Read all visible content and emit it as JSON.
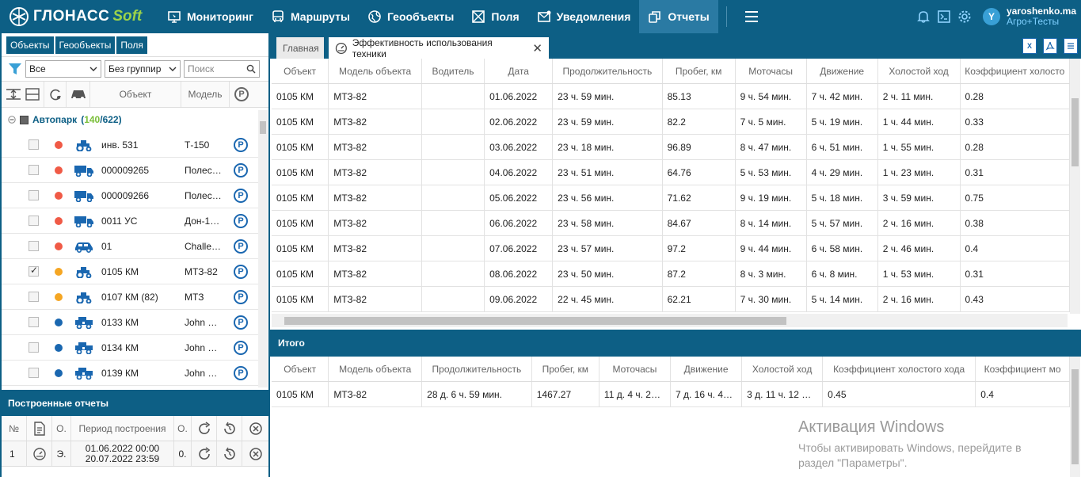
{
  "app": {
    "logo_main": "ГЛОНАСС",
    "logo_soft": "Soft",
    "nav": [
      {
        "label": "Мониторинг",
        "icon": "monitor-icon"
      },
      {
        "label": "Маршруты",
        "icon": "bus-icon"
      },
      {
        "label": "Геообъекты",
        "icon": "globe-icon"
      },
      {
        "label": "Поля",
        "icon": "field-icon"
      },
      {
        "label": "Уведомления",
        "icon": "mail-icon"
      },
      {
        "label": "Отчеты",
        "icon": "reports-icon"
      }
    ],
    "active_nav": "Отчеты",
    "user": {
      "initial": "Y",
      "name": "yaroshenko.ma",
      "org": "Агро+Тесты"
    }
  },
  "left": {
    "tabs": [
      "Объекты",
      "Геообъекты",
      "Поля"
    ],
    "filter_select": "Все",
    "group_select": "Без группир",
    "search_placeholder": "Поиск",
    "columns": {
      "object": "Объект",
      "model": "Модель"
    },
    "group": {
      "name": "Автопарк",
      "open_paren": "(",
      "online": "140",
      "slash": "/",
      "total": "622",
      "close_paren": ")"
    },
    "objects": [
      {
        "name": "инв. 531",
        "model": "Т-150",
        "status": "#f05a46",
        "vehicle": "tractor",
        "checked": false
      },
      {
        "name": "000009265",
        "model": "Полес…",
        "status": "#f05a46",
        "vehicle": "truck",
        "checked": false
      },
      {
        "name": "000009266",
        "model": "Полес…",
        "status": "#f05a46",
        "vehicle": "truck",
        "checked": false
      },
      {
        "name": "0011 УС",
        "model": "Дон-1…",
        "status": "#f05a46",
        "vehicle": "truck",
        "checked": false
      },
      {
        "name": "01",
        "model": "Challe…",
        "status": "#f05a46",
        "vehicle": "car",
        "checked": false
      },
      {
        "name": "0105 КМ",
        "model": "МТЗ-82",
        "status": "#f5a623",
        "vehicle": "tractor",
        "checked": true
      },
      {
        "name": "0107 КМ (82)",
        "model": "МТЗ",
        "status": "#f5a623",
        "vehicle": "tractor",
        "checked": false
      },
      {
        "name": "0133 КМ",
        "model": "John …",
        "status": "#1a67b0",
        "vehicle": "harvester",
        "checked": false
      },
      {
        "name": "0134 КМ",
        "model": "John …",
        "status": "#1a67b0",
        "vehicle": "harvester",
        "checked": false
      },
      {
        "name": "0139 КМ",
        "model": "John …",
        "status": "#1a67b0",
        "vehicle": "harvester",
        "checked": false
      }
    ],
    "reports": {
      "title": "Построенные отчеты",
      "columns": {
        "num": "№",
        "o1": "О.",
        "period": "Период построения",
        "o2": "О."
      },
      "rows": [
        {
          "num": "1",
          "o1": "Э.",
          "period_start": "01.06.2022 00:00",
          "period_end": "20.07.2022 23:59",
          "o2": "0."
        }
      ]
    }
  },
  "right": {
    "tabs": [
      {
        "label": "Главная"
      },
      {
        "label": "Эффективность использования техники"
      }
    ],
    "columns": [
      "Объект",
      "Модель объекта",
      "Водитель",
      "Дата",
      "Продолжительность",
      "Пробег, км",
      "Моточасы",
      "Движение",
      "Холостой ход",
      "Коэффициент холосто"
    ],
    "rows": [
      [
        "0105 КМ",
        "МТЗ-82",
        "",
        "01.06.2022",
        "23 ч. 59 мин.",
        "85.13",
        "9 ч. 54 мин.",
        "7 ч. 42 мин.",
        "2 ч. 11 мин.",
        "0.28"
      ],
      [
        "0105 КМ",
        "МТЗ-82",
        "",
        "02.06.2022",
        "23 ч. 59 мин.",
        "82.2",
        "7 ч. 5 мин.",
        "5 ч. 19 мин.",
        "1 ч. 44 мин.",
        "0.33"
      ],
      [
        "0105 КМ",
        "МТЗ-82",
        "",
        "03.06.2022",
        "23 ч. 18 мин.",
        "96.89",
        "8 ч. 47 мин.",
        "6 ч. 51 мин.",
        "1 ч. 55 мин.",
        "0.28"
      ],
      [
        "0105 КМ",
        "МТЗ-82",
        "",
        "04.06.2022",
        "23 ч. 51 мин.",
        "64.76",
        "5 ч. 53 мин.",
        "4 ч. 29 мин.",
        "1 ч. 23 мин.",
        "0.31"
      ],
      [
        "0105 КМ",
        "МТЗ-82",
        "",
        "05.06.2022",
        "23 ч. 56 мин.",
        "71.62",
        "9 ч. 19 мин.",
        "5 ч. 18 мин.",
        "3 ч. 59 мин.",
        "0.75"
      ],
      [
        "0105 КМ",
        "МТЗ-82",
        "",
        "06.06.2022",
        "23 ч. 58 мин.",
        "84.67",
        "8 ч. 14 мин.",
        "5 ч. 57 мин.",
        "2 ч. 16 мин.",
        "0.38"
      ],
      [
        "0105 КМ",
        "МТЗ-82",
        "",
        "07.06.2022",
        "23 ч. 57 мин.",
        "97.2",
        "9 ч. 44 мин.",
        "6 ч. 58 мин.",
        "2 ч. 46 мин.",
        "0.4"
      ],
      [
        "0105 КМ",
        "МТЗ-82",
        "",
        "08.06.2022",
        "23 ч. 50 мин.",
        "87.2",
        "8 ч. 3 мин.",
        "6 ч. 8 мин.",
        "1 ч. 53 мин.",
        "0.31"
      ],
      [
        "0105 КМ",
        "МТЗ-82",
        "",
        "09.06.2022",
        "22 ч. 45 мин.",
        "62.21",
        "7 ч. 30 мин.",
        "5 ч. 14 мин.",
        "2 ч. 16 мин.",
        "0.43"
      ]
    ],
    "totals": {
      "title": "Итого",
      "columns": [
        "Объект",
        "Модель объекта",
        "Продолжительность",
        "Пробег, км",
        "Моточасы",
        "Движение",
        "Холостой ход",
        "Коэффициент холостого хода",
        "Коэффициент мо"
      ],
      "rows": [
        [
          "0105 КМ",
          "МТЗ-82",
          "28 д. 6 ч. 59 мин.",
          "1467.27",
          "11 д. 4 ч. 2…",
          "7 д. 16 ч. 4…",
          "3 д. 11 ч. 12 …",
          "0.45",
          "0.4"
        ]
      ]
    }
  },
  "watermark": {
    "title": "Активация Windows",
    "line1": "Чтобы активировать Windows, перейдите в",
    "line2": "раздел \"Параметры\"."
  }
}
